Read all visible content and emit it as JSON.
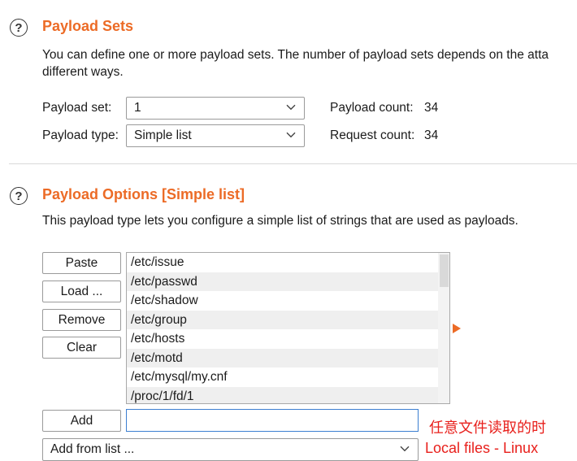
{
  "payload_sets": {
    "title": "Payload Sets",
    "description_line1": "You can define one or more payload sets. The number of payload sets depends on the atta",
    "description_line2": "different ways.",
    "set_label": "Payload set:",
    "set_value": "1",
    "type_label": "Payload type:",
    "type_value": "Simple list",
    "payload_count_label": "Payload count:",
    "payload_count": "34",
    "request_count_label": "Request count:",
    "request_count": "34"
  },
  "payload_options": {
    "title": "Payload Options [Simple list]",
    "description": "This payload type lets you configure a simple list of strings that are used as payloads.",
    "buttons": {
      "paste": "Paste",
      "load": "Load ...",
      "remove": "Remove",
      "clear": "Clear",
      "add": "Add"
    },
    "list_items": [
      "/etc/issue",
      "/etc/passwd",
      "/etc/shadow",
      "/etc/group",
      "/etc/hosts",
      "/etc/motd",
      "/etc/mysql/my.cnf",
      "/proc/1/fd/1"
    ],
    "add_input_value": "",
    "add_from_list": "Add from list ..."
  },
  "annotation": {
    "line1": "任意文件读取的时",
    "line2": "Local files - Linux"
  },
  "colors": {
    "heading": "#ec6b26",
    "annotation": "#e8201c",
    "input_focus": "#3c7fd1"
  }
}
